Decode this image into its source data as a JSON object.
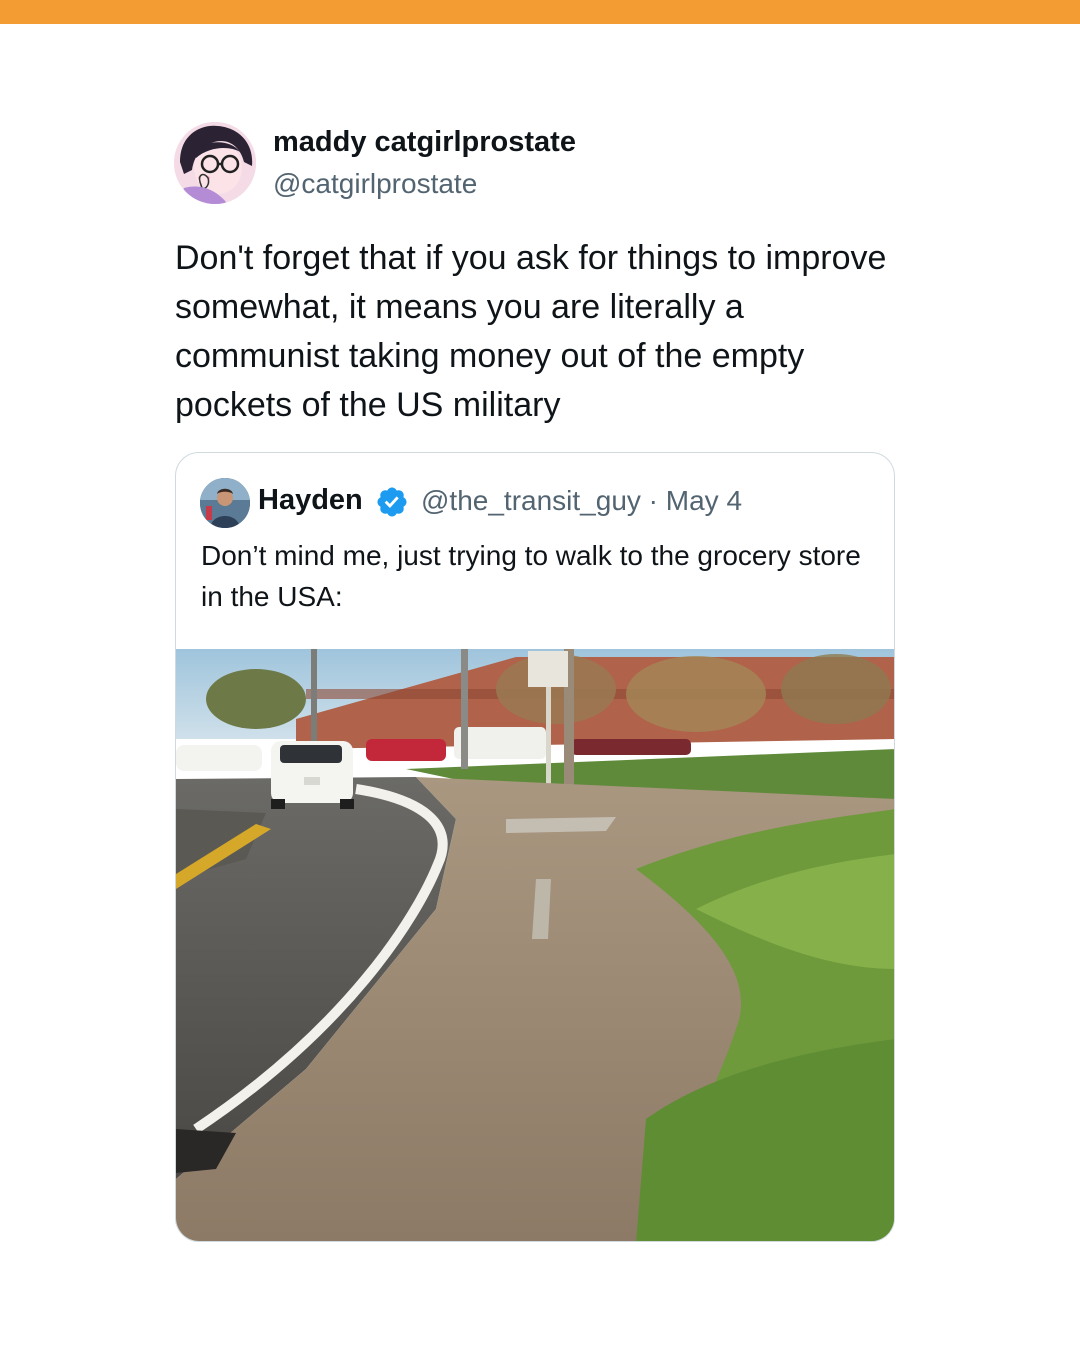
{
  "post": {
    "author_name": "maddy catgirlprostate",
    "author_handle": "@catgirlprostate",
    "text": "Don't forget that if you ask for things to improve somewhat, it means you are literally a communist taking money out of the empty pockets of the US military"
  },
  "quoted_post": {
    "author_name": "Hayden",
    "verified": true,
    "author_handle": "@the_transit_guy",
    "separator": "·",
    "date": "May 4",
    "text": "Don’t mind me, just trying to walk to the grocery store in the USA:"
  },
  "icons": {
    "verified": "verified-badge-icon"
  },
  "colors": {
    "top_bar": "#f39c34",
    "verified": "#1d9bf0",
    "secondary_text": "#536471"
  }
}
